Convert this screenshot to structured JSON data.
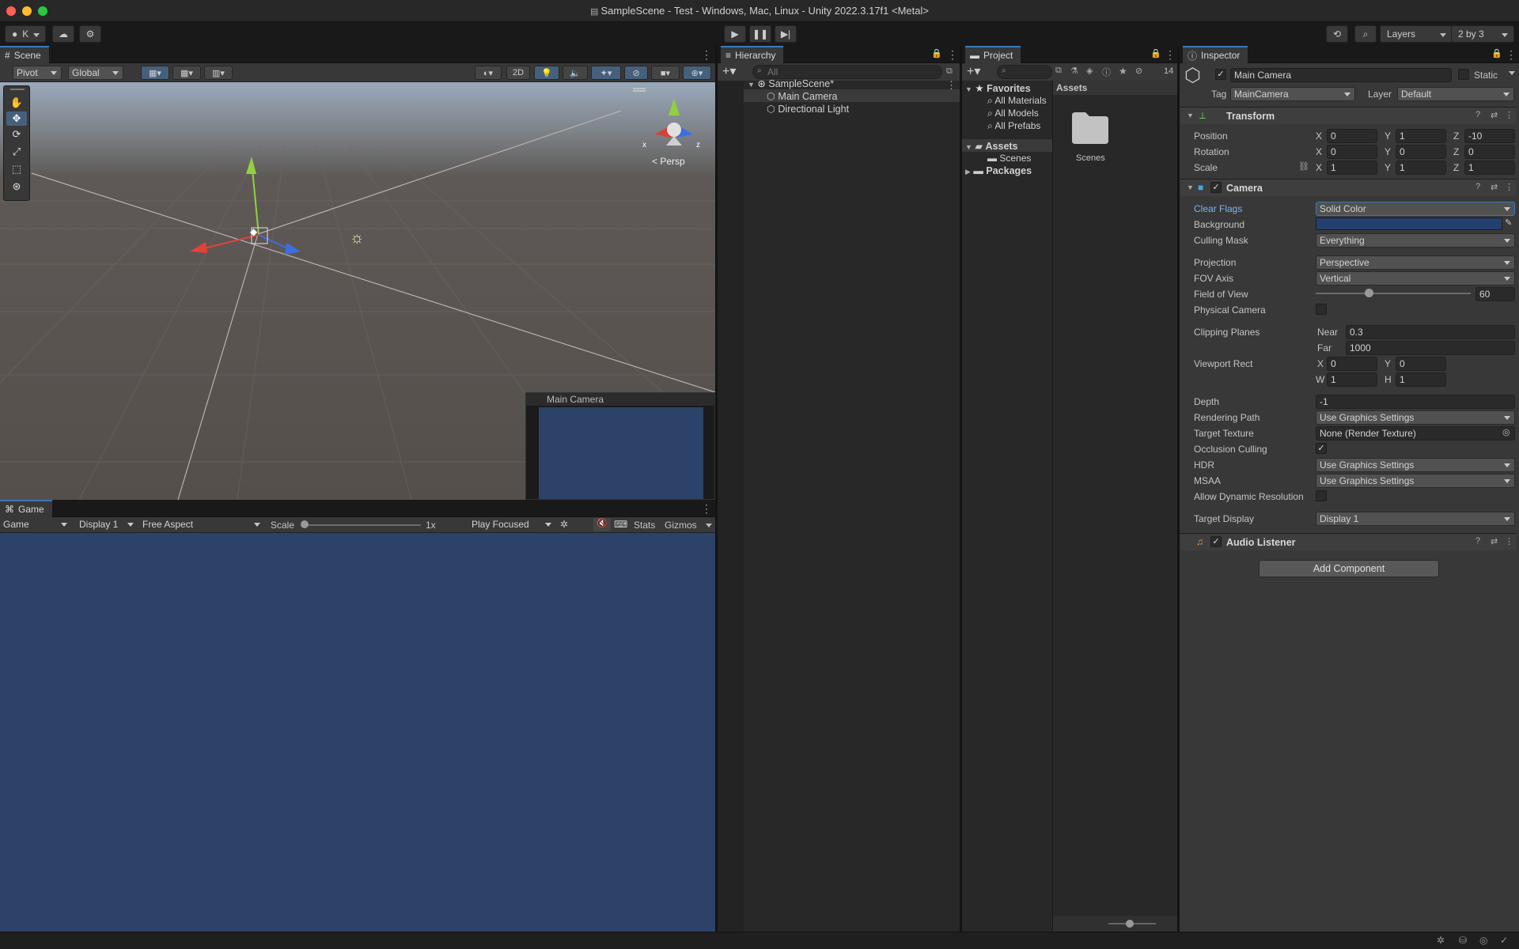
{
  "window": {
    "title": "SampleScene - Test - Windows, Mac, Linux - Unity 2022.3.17f1 <Metal>"
  },
  "toolbar": {
    "account": "K",
    "layers": "Layers",
    "layout": "2 by 3"
  },
  "scene": {
    "tab": "Scene",
    "pivot": "Pivot",
    "global": "Global",
    "mode2d": "2D",
    "persp": "< Persp",
    "gizmo_x": "x",
    "gizmo_z": "z",
    "preview_title": "Main Camera"
  },
  "game": {
    "tab": "Game",
    "mode": "Game",
    "display": "Display 1",
    "aspect": "Free Aspect",
    "scale_label": "Scale",
    "scale_value": "1x",
    "play_mode": "Play Focused",
    "stats": "Stats",
    "gizmos": "Gizmos",
    "bg_color": "#2c4268"
  },
  "hierarchy": {
    "tab": "Hierarchy",
    "search_placeholder": "All",
    "scene_name": "SampleScene*",
    "items": [
      "Main Camera",
      "Directional Light"
    ]
  },
  "project": {
    "tab": "Project",
    "search_count": "14",
    "favorites": "Favorites",
    "favorite_items": [
      "All Materials",
      "All Models",
      "All Prefabs"
    ],
    "assets": "Assets",
    "scenes": "Scenes",
    "packages": "Packages",
    "assets_header": "Assets",
    "folder_name": "Scenes"
  },
  "inspector": {
    "tab": "Inspector",
    "object_name": "Main Camera",
    "static_label": "Static",
    "tag_label": "Tag",
    "tag_value": "MainCamera",
    "layer_label": "Layer",
    "layer_value": "Default",
    "transform": {
      "title": "Transform",
      "position_label": "Position",
      "position": [
        "0",
        "1",
        "-10"
      ],
      "rotation_label": "Rotation",
      "rotation": [
        "0",
        "0",
        "0"
      ],
      "scale_label": "Scale",
      "scale": [
        "1",
        "1",
        "1"
      ]
    },
    "camera": {
      "title": "Camera",
      "clear_flags_label": "Clear Flags",
      "clear_flags": "Solid Color",
      "background_label": "Background",
      "background_color": "#233f6e",
      "culling_mask_label": "Culling Mask",
      "culling_mask": "Everything",
      "projection_label": "Projection",
      "projection": "Perspective",
      "fov_axis_label": "FOV Axis",
      "fov_axis": "Vertical",
      "fov_label": "Field of View",
      "fov_value": "60",
      "fov_fraction": 0.34,
      "physical_label": "Physical Camera",
      "clipping_label": "Clipping Planes",
      "near_label": "Near",
      "near": "0.3",
      "far_label": "Far",
      "far": "1000",
      "viewport_label": "Viewport Rect",
      "vx": "0",
      "vy": "0",
      "vw": "1",
      "vh": "1",
      "depth_label": "Depth",
      "depth": "-1",
      "rendering_path_label": "Rendering Path",
      "rendering_path": "Use Graphics Settings",
      "target_texture_label": "Target Texture",
      "target_texture": "None (Render Texture)",
      "occlusion_label": "Occlusion Culling",
      "hdr_label": "HDR",
      "hdr": "Use Graphics Settings",
      "msaa_label": "MSAA",
      "msaa": "Use Graphics Settings",
      "dynres_label": "Allow Dynamic Resolution",
      "target_display_label": "Target Display",
      "target_display": "Display 1"
    },
    "audio_listener": {
      "title": "Audio Listener"
    },
    "add_component": "Add Component"
  }
}
